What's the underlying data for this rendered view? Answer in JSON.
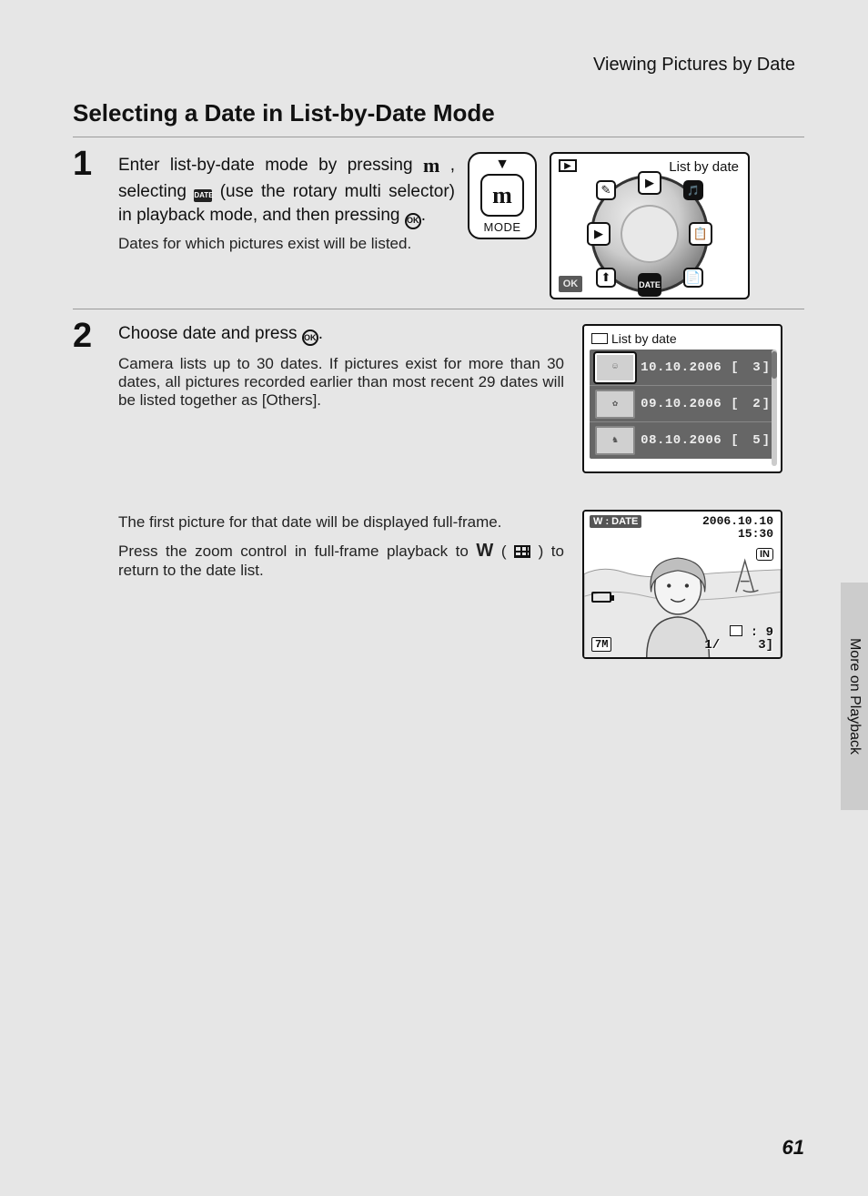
{
  "header": {
    "breadcrumb": "Viewing Pictures by Date"
  },
  "title": "Selecting a Date in List-by-Date Mode",
  "side_tab": "More on Playback",
  "page_number": "61",
  "step1": {
    "num": "1",
    "instr_a": "Enter list-by-date mode by pressing ",
    "instr_b": ", selecting ",
    "instr_c": " (use the rotary multi selector) in playback mode, and then pressing ",
    "instr_d": ".",
    "sub": "Dates for which pictures exist will be listed.",
    "mode_label": "MODE",
    "mode_glyph": "m",
    "lcd_title": "List by date",
    "ok_badge": "OK",
    "dial_bottom": "DATE"
  },
  "step2": {
    "num": "2",
    "head_a": "Choose date and press ",
    "head_b": ".",
    "body": "Camera lists up to 30 dates. If pictures exist for more than 30 dates, all pictures recorded earlier than most recent 29 dates will be listed together as [Others].",
    "list_title": "List by date",
    "rows": [
      {
        "date": "10.10.2006",
        "count": "3"
      },
      {
        "date": "09.10.2006",
        "count": "2"
      },
      {
        "date": "08.10.2006",
        "count": "5"
      }
    ]
  },
  "step3": {
    "p1": "The first picture for that date will be displayed full-frame.",
    "p2_a": "Press the zoom control in full-frame playback to ",
    "p2_b": " (",
    "p2_c": ") to return to the date list.",
    "preview": {
      "badge": "W : DATE",
      "date": "2006.10.10",
      "time": "15:30",
      "in": "IN",
      "resolution": "7M",
      "counter_left": "1/",
      "stack_top": ": 9",
      "stack_bottom": "3]"
    }
  }
}
